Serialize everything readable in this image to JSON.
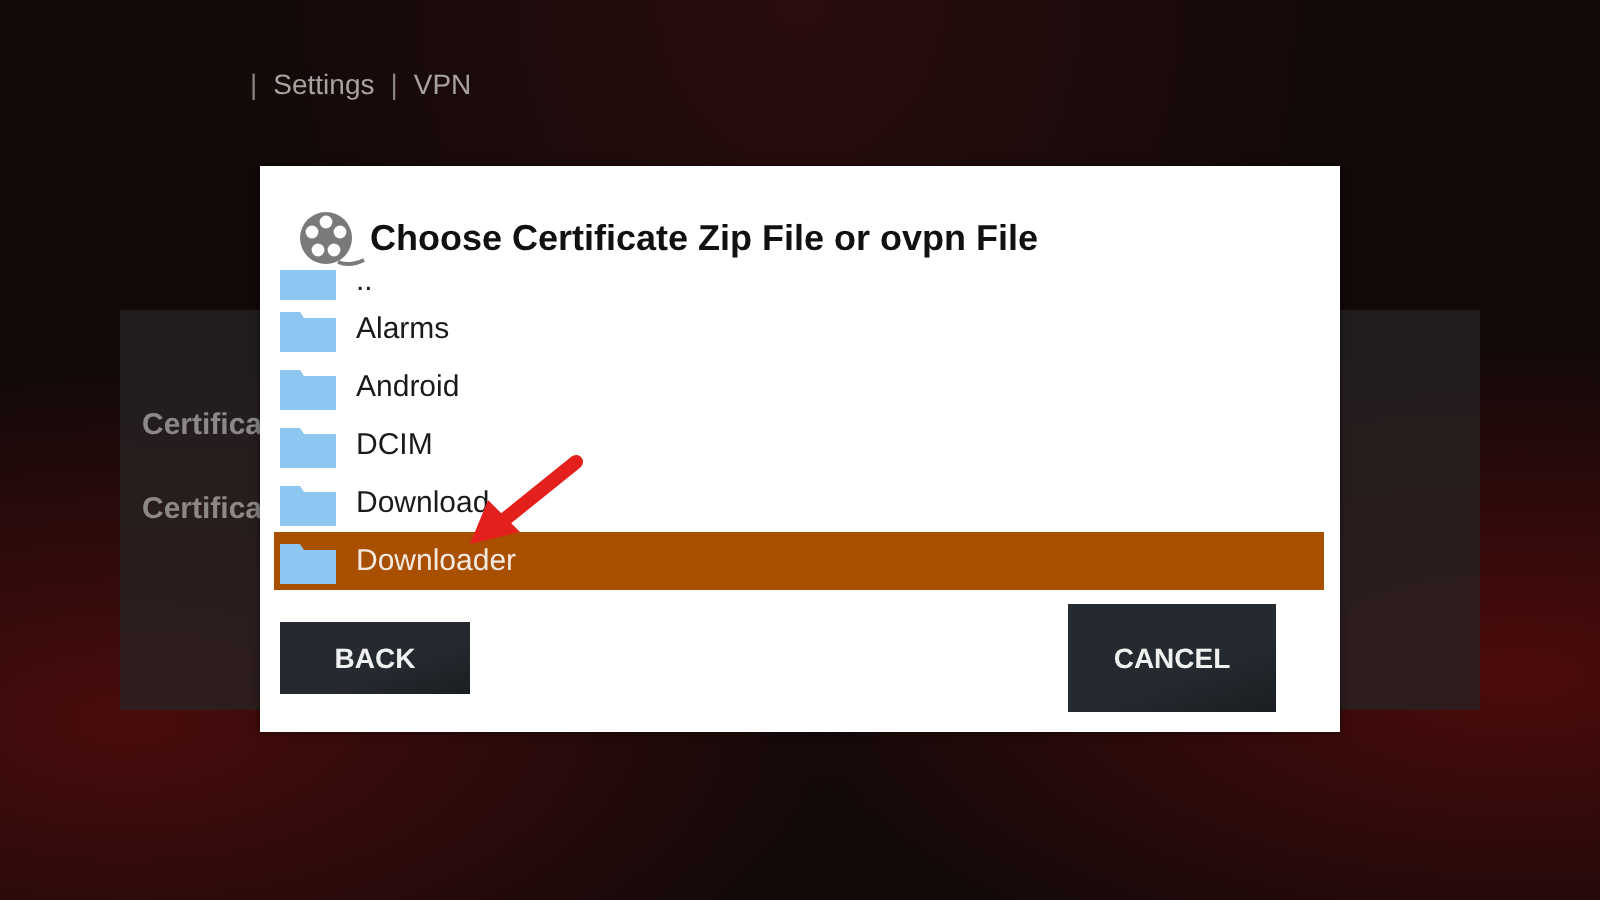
{
  "breadcrumb": [
    "|",
    "Settings",
    "|",
    "VPN"
  ],
  "settings_panel": {
    "labels": [
      "Certifica",
      "Certifica"
    ]
  },
  "dialog": {
    "title": "Choose Certificate Zip File or ovpn File",
    "items": [
      {
        "name": "..",
        "selected": false
      },
      {
        "name": "Alarms",
        "selected": false
      },
      {
        "name": "Android",
        "selected": false
      },
      {
        "name": "DCIM",
        "selected": false
      },
      {
        "name": "Download",
        "selected": false
      },
      {
        "name": "Downloader",
        "selected": true
      }
    ],
    "buttons": [
      {
        "label": "BACK",
        "kind": "back"
      },
      {
        "label": "CANCEL",
        "kind": "cancel"
      }
    ]
  }
}
